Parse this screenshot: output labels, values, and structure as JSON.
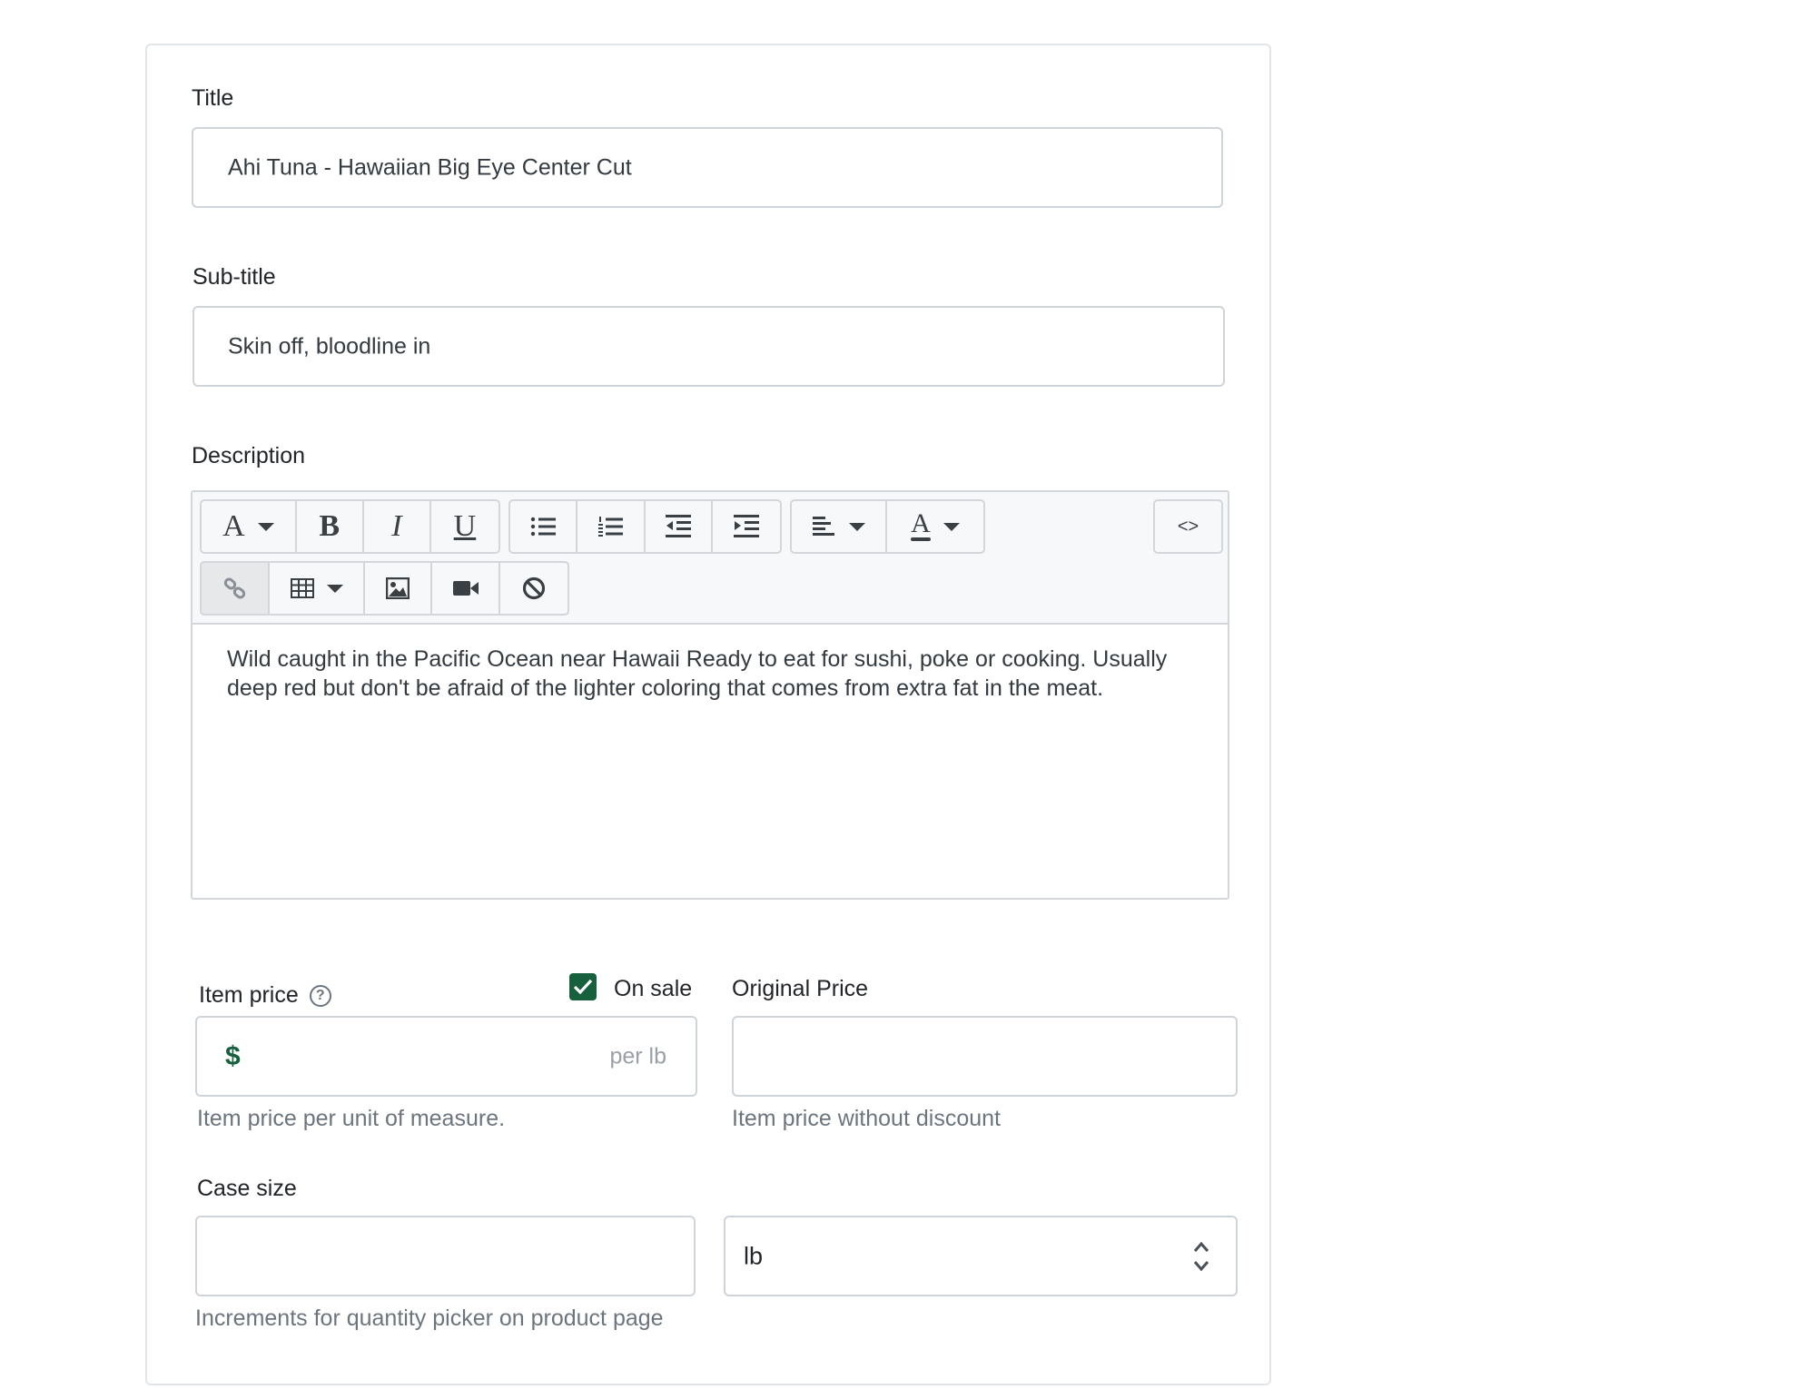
{
  "title": {
    "label": "Title",
    "value": "Ahi Tuna - Hawaiian Big Eye Center Cut"
  },
  "subtitle": {
    "label": "Sub-title",
    "value": "Skin off, bloodline in"
  },
  "description": {
    "label": "Description",
    "toolbar": {
      "font_glyph": "A",
      "bold_glyph": "B",
      "italic_glyph": "I",
      "underline_glyph": "U",
      "color_glyph": "A",
      "code_view_glyph": "<>"
    },
    "content": "Wild caught in the Pacific Ocean near Hawaii Ready to eat for sushi, poke or cooking. Usually deep red but don't be afraid of the lighter coloring that comes from extra fat in the meat."
  },
  "item_price": {
    "label": "Item price",
    "help_glyph": "?",
    "on_sale_label": "On sale",
    "on_sale_checked": true,
    "currency_symbol": "$",
    "unit_suffix": "per lb",
    "value": "",
    "help_text": "Item price per unit of measure."
  },
  "original_price": {
    "label": "Original Price",
    "value": "",
    "help_text": "Item price without discount"
  },
  "case_size": {
    "label": "Case size",
    "value": "",
    "help_text": "Increments for quantity picker on product page",
    "unit_selected": "lb"
  },
  "colors": {
    "accent_green": "#17603d",
    "border": "#cfd4d9",
    "help_text": "#6c757d"
  }
}
